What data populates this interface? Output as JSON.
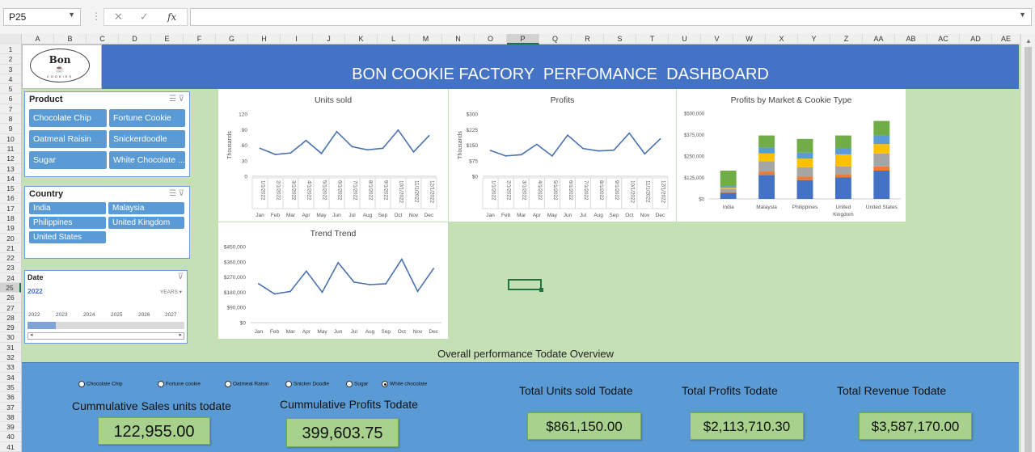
{
  "formula_bar": {
    "name_box": "P25",
    "fx": "fx",
    "cancel": "✕",
    "enter": "✓",
    "formula": ""
  },
  "columns": [
    "A",
    "B",
    "C",
    "D",
    "E",
    "F",
    "G",
    "H",
    "I",
    "J",
    "K",
    "L",
    "M",
    "N",
    "O",
    "P",
    "Q",
    "R",
    "S",
    "T",
    "U",
    "V",
    "W",
    "X",
    "Y",
    "Z",
    "AA",
    "AB",
    "AC",
    "AD",
    "AE"
  ],
  "selected_column": "P",
  "rows": [
    "1",
    "2",
    "3",
    "4",
    "5",
    "6",
    "7",
    "8",
    "9",
    "10",
    "11",
    "12",
    "13",
    "14",
    "15",
    "16",
    "17",
    "18",
    "19",
    "20",
    "21",
    "22",
    "23",
    "24",
    "25",
    "26",
    "27",
    "28",
    "29",
    "30",
    "31",
    "32",
    "33",
    "34",
    "35",
    "36",
    "37",
    "38",
    "39",
    "40",
    "41"
  ],
  "selected_row": "25",
  "logo": {
    "line1": "Bon",
    "line2": "☕",
    "line3": "COOKIES"
  },
  "dashboard_title": "BON COOKIE FACTORY  PERFOMANCE  DASHBOARD",
  "product_slicer": {
    "title": "Product",
    "items": [
      "Chocolate Chip",
      "Fortune Cookie",
      "Oatmeal Raisin",
      "Snickerdoodle",
      "Sugar",
      "White Chocolate ..."
    ]
  },
  "country_slicer": {
    "title": "Country",
    "items": [
      "India",
      "Malaysia",
      "Philippines",
      "United Kingdom",
      "United States"
    ]
  },
  "date_timeline": {
    "title": "Date",
    "selected_year": "2022",
    "level": "YEARS",
    "years": [
      "2022",
      "2023",
      "2024",
      "2025",
      "2026",
      "2027"
    ],
    "selected_fraction": 0.18
  },
  "chart_data": [
    {
      "type": "line",
      "title": "Units sold",
      "ylabel": "Thousands",
      "y_ticks": [
        "120",
        "90",
        "60",
        "30",
        "0"
      ],
      "ylim": [
        0,
        120
      ],
      "x_dates": [
        "1/1/2022",
        "2/1/2022",
        "3/1/2022",
        "4/1/2022",
        "5/1/2022",
        "6/1/2022",
        "7/1/2022",
        "8/1/2022",
        "9/1/2022",
        "10/1/2022",
        "11/1/2022",
        "12/1/2022"
      ],
      "x_months": [
        "Jan",
        "Feb",
        "Mar",
        "Apr",
        "May",
        "Jun",
        "Jul",
        "Aug",
        "Sep",
        "Oct",
        "Nov",
        "Dec"
      ],
      "values": [
        54,
        42,
        45,
        69,
        44,
        86,
        57,
        51,
        54,
        89,
        47,
        78
      ]
    },
    {
      "type": "line",
      "title": "Profits",
      "ylabel": "Thousands",
      "y_ticks": [
        "$300",
        "$225",
        "$150",
        "$75",
        "$0"
      ],
      "ylim": [
        0,
        300
      ],
      "x_dates": [
        "1/1/2022",
        "2/1/2022",
        "3/1/2022",
        "4/1/2022",
        "5/1/2022",
        "6/1/2022",
        "7/1/2022",
        "8/1/2022",
        "9/1/2022",
        "10/1/2022",
        "11/1/2022",
        "12/1/2022"
      ],
      "x_months": [
        "Jan",
        "Feb",
        "Mar",
        "Apr",
        "May",
        "Jun",
        "Jul",
        "Aug",
        "Sep",
        "Oct",
        "Nov",
        "Dec"
      ],
      "values": [
        124,
        98,
        104,
        154,
        98,
        198,
        134,
        122,
        126,
        208,
        108,
        180
      ]
    },
    {
      "type": "bar",
      "stacked": true,
      "title": "Profits by Market & Cookie Type",
      "y_ticks": [
        "$500,000",
        "$375,000",
        "$250,000",
        "$125,000",
        "$0"
      ],
      "ylim": [
        0,
        500000
      ],
      "categories": [
        "India",
        "Malaysia",
        "Philippines",
        "United Kingdom",
        "United States"
      ],
      "series": [
        {
          "color": "#4472c4",
          "values": [
            35000,
            140000,
            110000,
            125000,
            165000
          ]
        },
        {
          "color": "#ed7d31",
          "values": [
            5000,
            20000,
            20000,
            20000,
            25000
          ]
        },
        {
          "color": "#a5a5a5",
          "values": [
            20000,
            60000,
            55000,
            45000,
            75000
          ]
        },
        {
          "color": "#ffc000",
          "values": [
            5000,
            45000,
            50000,
            70000,
            55000
          ]
        },
        {
          "color": "#5b9bd5",
          "values": [
            10000,
            35000,
            35000,
            35000,
            50000
          ]
        },
        {
          "color": "#70ad47",
          "values": [
            90000,
            70000,
            80000,
            75000,
            85000
          ]
        }
      ]
    },
    {
      "type": "line",
      "title": "Trend Trend",
      "y_ticks": [
        "$450,000",
        "$360,000",
        "$270,000",
        "$180,000",
        "$90,000",
        "$0"
      ],
      "ylim": [
        0,
        450000
      ],
      "x_months": [
        "Jan",
        "Feb",
        "Mar",
        "Apr",
        "May",
        "Jun",
        "Jul",
        "Aug",
        "Sep",
        "Oct",
        "Nov",
        "Dec"
      ],
      "values": [
        230000,
        170000,
        185000,
        305000,
        180000,
        355000,
        240000,
        225000,
        230000,
        375000,
        185000,
        320000
      ]
    }
  ],
  "overview_label": "Overall performance Todate Overview",
  "radio_options": [
    {
      "label": "Chocolate Chip",
      "checked": false
    },
    {
      "label": "Fortune cookie",
      "checked": false
    },
    {
      "label": "Oatmeal Raisin",
      "checked": false
    },
    {
      "label": "Snicker Doodle",
      "checked": false
    },
    {
      "label": "Sugar",
      "checked": false
    },
    {
      "label": "White chocolate",
      "checked": true
    }
  ],
  "kpis": {
    "cum_units_label": "Cummulative Sales units todate",
    "cum_units_value": "122,955.00",
    "cum_profits_label": "Cummulative Profits Todate",
    "cum_profits_value": "399,603.75",
    "total_units_label": "Total Units sold Todate",
    "total_units_value": "$861,150.00",
    "total_profits_label": "Total Profits Todate",
    "total_profits_value": "$2,113,710.30",
    "total_revenue_label": "Total Revenue Todate",
    "total_revenue_value": "$3,587,170.00"
  },
  "colors": {
    "title_band": "#4472c4",
    "sheet_bg": "#c5e0b4",
    "kpi_panel": "#5b9bd5",
    "kpi_box": "#a9d18e",
    "slicer_button": "#5b9bd5",
    "line": "#4a72b0"
  }
}
